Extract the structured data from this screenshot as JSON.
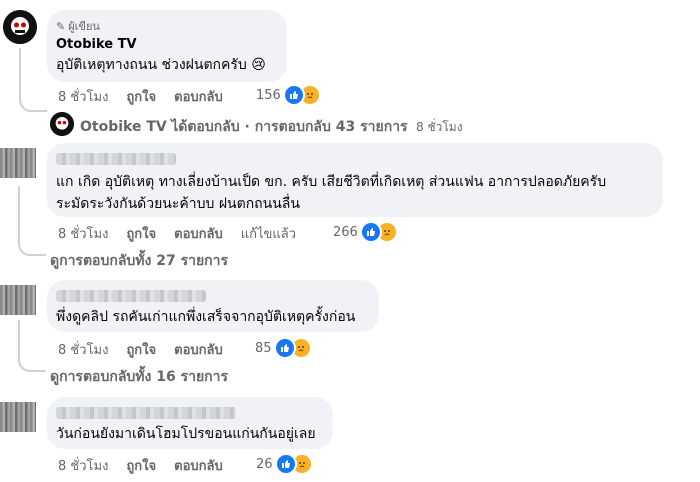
{
  "comment1": {
    "badge": "ผู้เขียน",
    "author": "Otobike TV",
    "text": "อุบัติเหตุทางถนน ช่วงฝนตกครับ",
    "emoji": "😢",
    "time": "8 ชั่วโมง",
    "like": "ถูกใจ",
    "reply": "ตอบกลับ",
    "reactions": "156"
  },
  "reply_summary": {
    "author": "Otobike TV",
    "text": "ได้ตอบกลับ · การตอบกลับ 43 รายการ",
    "time": "8 ชั่วโมง"
  },
  "comment2": {
    "text_line1": "แก เกิด อุบัติเหตุ ทางเลี่ยงบ้านเป็ด ขก. ครับ เสียชีวิตที่เกิดเหตุ ส่วนแฟน อาการปลอดภัยครับ",
    "text_line2": "ระมัดระวังกันด้วยนะค้าบบ ฝนตกถนนลื่น",
    "time": "8 ชั่วโมง",
    "like": "ถูกใจ",
    "reply": "ตอบกลับ",
    "edited": "แก้ไขแล้ว",
    "reactions": "266",
    "view_replies": "ดูการตอบกลับทั้ง 27 รายการ"
  },
  "comment3": {
    "text": "พึ่งดูคลิป รถคันเก่าแกพึ่งเสร็จจากอุบัติเหตุครั้งก่อน",
    "time": "8 ชั่วโมง",
    "like": "ถูกใจ",
    "reply": "ตอบกลับ",
    "reactions": "85",
    "view_replies": "ดูการตอบกลับทั้ง 16 รายการ"
  },
  "comment4": {
    "text": "วันก่อนยังมาเดินโฮมโปรขอนแก่นกันอยู่เลย",
    "time": "8 ชั่วโมง",
    "like": "ถูกใจ",
    "reply": "ตอบกลับ",
    "reactions": "26"
  },
  "colors": {
    "like": "#1877f2",
    "sad": "#f7b125",
    "bubble": "#f0f2f5",
    "meta": "#65676b"
  }
}
